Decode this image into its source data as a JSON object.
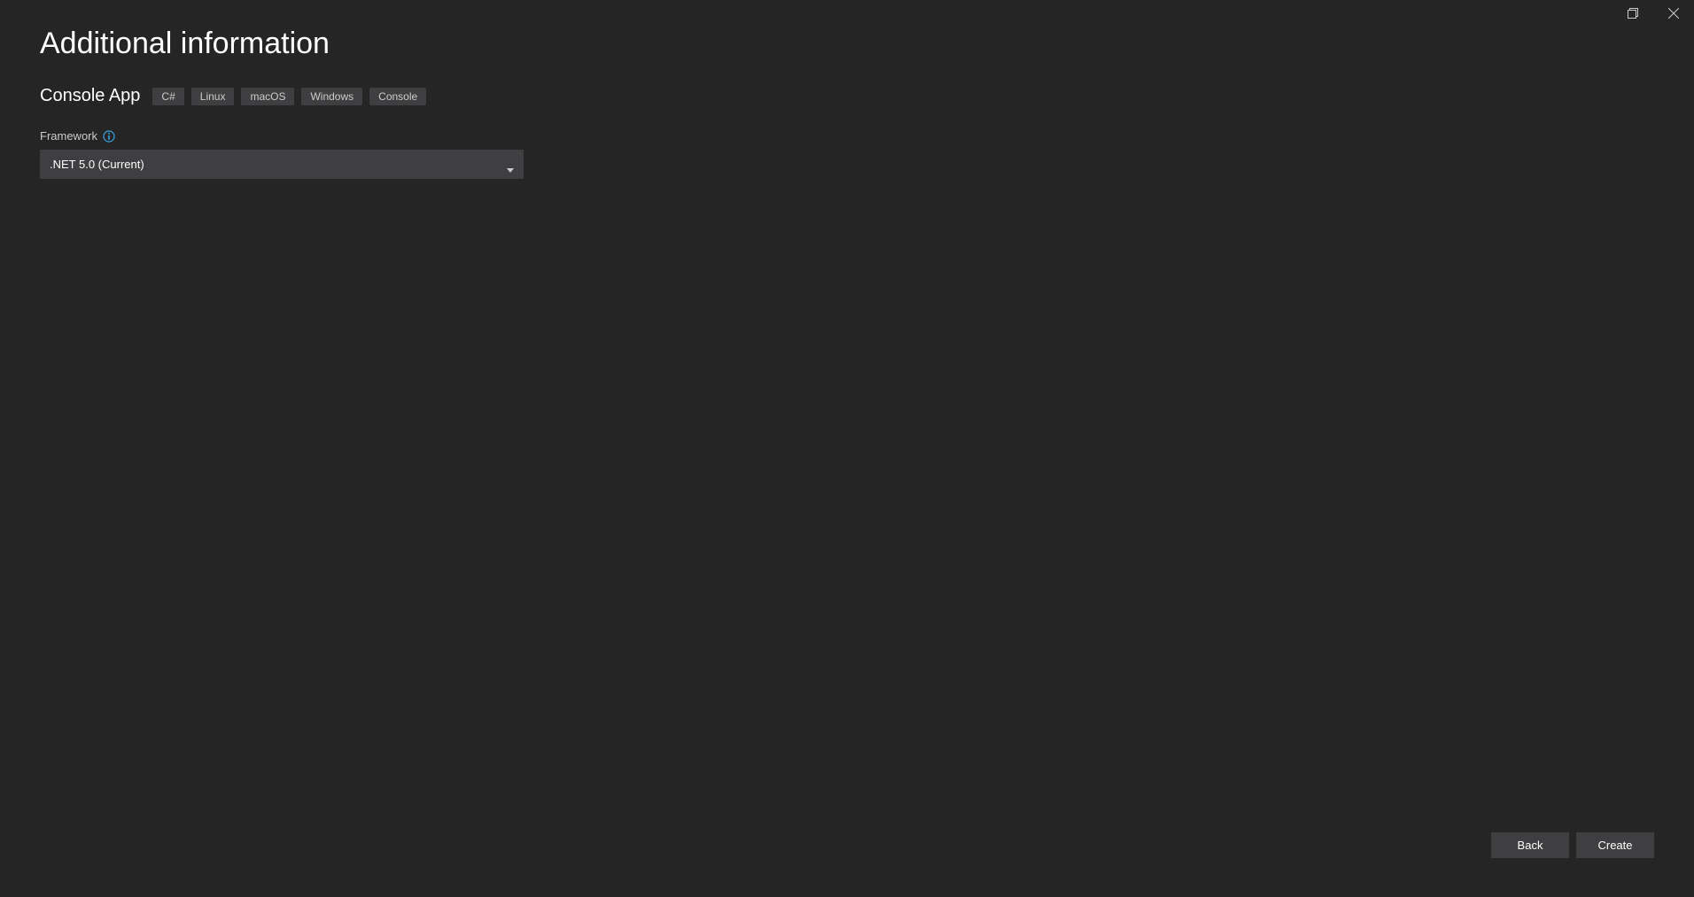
{
  "page_title": "Additional information",
  "project_name": "Console App",
  "tags": [
    "C#",
    "Linux",
    "macOS",
    "Windows",
    "Console"
  ],
  "framework": {
    "label": "Framework",
    "selected": ".NET 5.0 (Current)"
  },
  "buttons": {
    "back": "Back",
    "create": "Create"
  }
}
